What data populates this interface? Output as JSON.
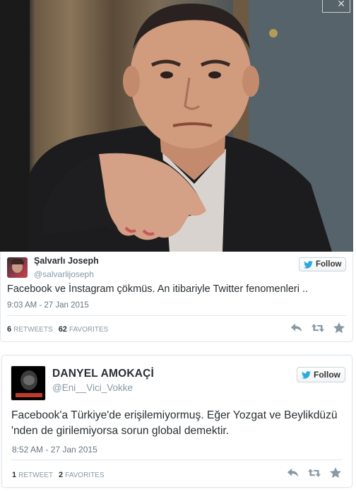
{
  "tweets": [
    {
      "name": "Şalvarlı Joseph",
      "handle": "@salvarlijoseph",
      "follow_label": "Follow",
      "text": "Facebook ve İnstagram çökmüs. An itibariyle Twitter fenomenleri ..",
      "time": "9:03 AM - 27 Jan 2015",
      "retweets": "6",
      "retweets_label": "RETWEETS",
      "favorites": "62",
      "favorites_label": "FAVORITES"
    },
    {
      "name": "DANYEL AMOKAÇİ",
      "handle": "@Eni__Vici_Vokke",
      "follow_label": "Follow",
      "text": "Facebook'a Türkiye'de  erişilemiyormuş. Eğer Yozgat ve Beylikdüzü 'nden de girilemiyorsa sorun global demektir.",
      "time": "8:52 AM - 27 Jan 2015",
      "retweets": "1",
      "retweets_label": "RETWEET",
      "favorites": "2",
      "favorites_label": "FAVORITES"
    }
  ],
  "icons": {
    "follow": "twitter-bird-icon",
    "reply": "reply-icon",
    "retweet": "retweet-icon",
    "favorite": "star-icon"
  },
  "colors": {
    "follow_bird": "#2aa9e0",
    "action_gray": "#8899a6"
  }
}
